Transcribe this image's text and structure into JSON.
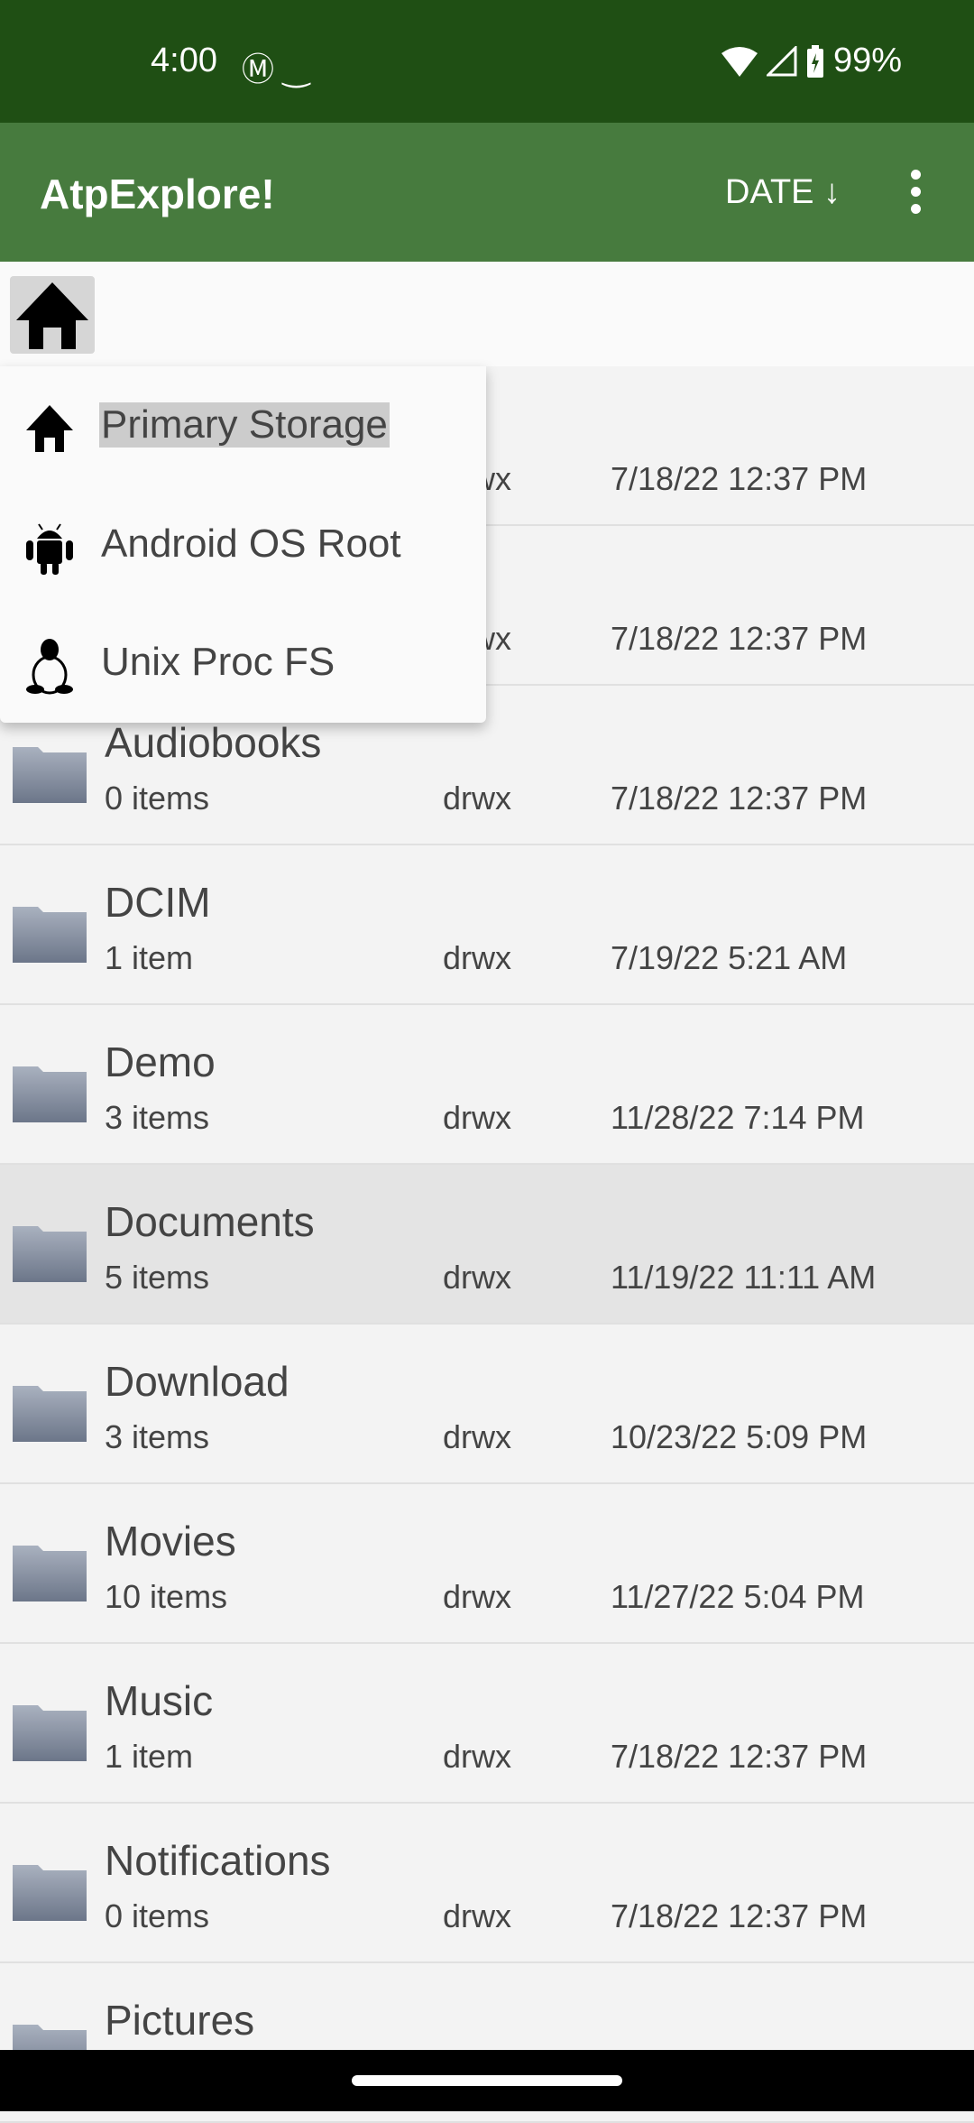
{
  "status_bar": {
    "time": "4:00",
    "notification_icons": [
      "gmail-icon",
      "amazon-icon"
    ],
    "battery": "99%"
  },
  "toolbar": {
    "title": "AtpExplore!",
    "sort_label": "DATE",
    "sort_icon": "arrow-down-icon"
  },
  "colors": {
    "status_bar": "#1f4f14",
    "toolbar": "#477b3e",
    "selected_row": "#e4e4e4"
  },
  "menu": {
    "items": [
      {
        "label": "Primary Storage",
        "icon": "home-icon",
        "highlighted": true
      },
      {
        "label": "Android OS Root",
        "icon": "android-icon"
      },
      {
        "label": "Unix Proc FS",
        "icon": "linux-tux-icon"
      }
    ]
  },
  "files": [
    {
      "name": "",
      "count": "",
      "perm": "drwx",
      "date": "7/18/22 12:37 PM"
    },
    {
      "name": "",
      "count": "",
      "perm": "drwx",
      "date": "7/18/22 12:37 PM"
    },
    {
      "name": "Audiobooks",
      "count": "0 items",
      "perm": "drwx",
      "date": "7/18/22 12:37 PM"
    },
    {
      "name": "DCIM",
      "count": "1 item",
      "perm": "drwx",
      "date": "7/19/22 5:21 AM"
    },
    {
      "name": "Demo",
      "count": "3 items",
      "perm": "drwx",
      "date": "11/28/22 7:14 PM"
    },
    {
      "name": "Documents",
      "count": "5 items",
      "perm": "drwx",
      "date": "11/19/22 11:11 AM",
      "selected": true
    },
    {
      "name": "Download",
      "count": "3 items",
      "perm": "drwx",
      "date": "10/23/22 5:09 PM"
    },
    {
      "name": "Movies",
      "count": "10 items",
      "perm": "drwx",
      "date": "11/27/22 5:04 PM"
    },
    {
      "name": "Music",
      "count": "1 item",
      "perm": "drwx",
      "date": "7/18/22 12:37 PM"
    },
    {
      "name": "Notifications",
      "count": "0 items",
      "perm": "drwx",
      "date": "7/18/22 12:37 PM"
    },
    {
      "name": "Pictures",
      "count": "",
      "perm": "",
      "date": ""
    }
  ]
}
